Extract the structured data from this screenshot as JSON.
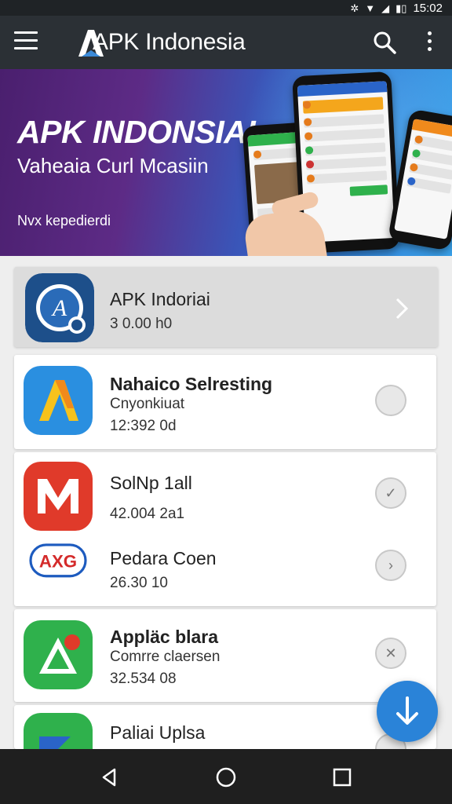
{
  "status_bar": {
    "time": "15:02"
  },
  "app_bar": {
    "title": "APK Indonesia"
  },
  "banner": {
    "title": "APK INDONSIAI",
    "subtitle": "Vaheaia Curl Mcasiin",
    "note": "Nvx kepedierdi"
  },
  "apps": [
    {
      "name": "APK Indoriai",
      "developer": "",
      "size": "3 0.00 h0",
      "action": "chevron"
    },
    {
      "name": "Nahaico Selresting",
      "developer": "Cnyonkiuat",
      "size": "12:392 0d",
      "action": "circle"
    },
    {
      "name": "SolNp 1all",
      "developer": "",
      "size": "42.004 2a1",
      "action": "check"
    },
    {
      "name": "Pedara Coen",
      "developer": "",
      "size": "26.30 10",
      "action": "chevron-circle"
    },
    {
      "name": "Appläc blara",
      "developer": "Comrre claersen",
      "size": "32.534 08",
      "action": "close"
    },
    {
      "name": "Paliai Uplsa",
      "developer": "",
      "size": "",
      "action": "circle"
    }
  ],
  "icons": {
    "menu": "menu-icon",
    "search": "search-icon",
    "more": "more-vert-icon",
    "download": "download-icon",
    "back": "back-icon",
    "home": "home-icon",
    "recents": "recents-icon"
  },
  "colors": {
    "app_bar": "#2b3035",
    "fab": "#2a83d8",
    "banner_start": "#4a1f6e",
    "banner_end": "#38a0e8"
  }
}
